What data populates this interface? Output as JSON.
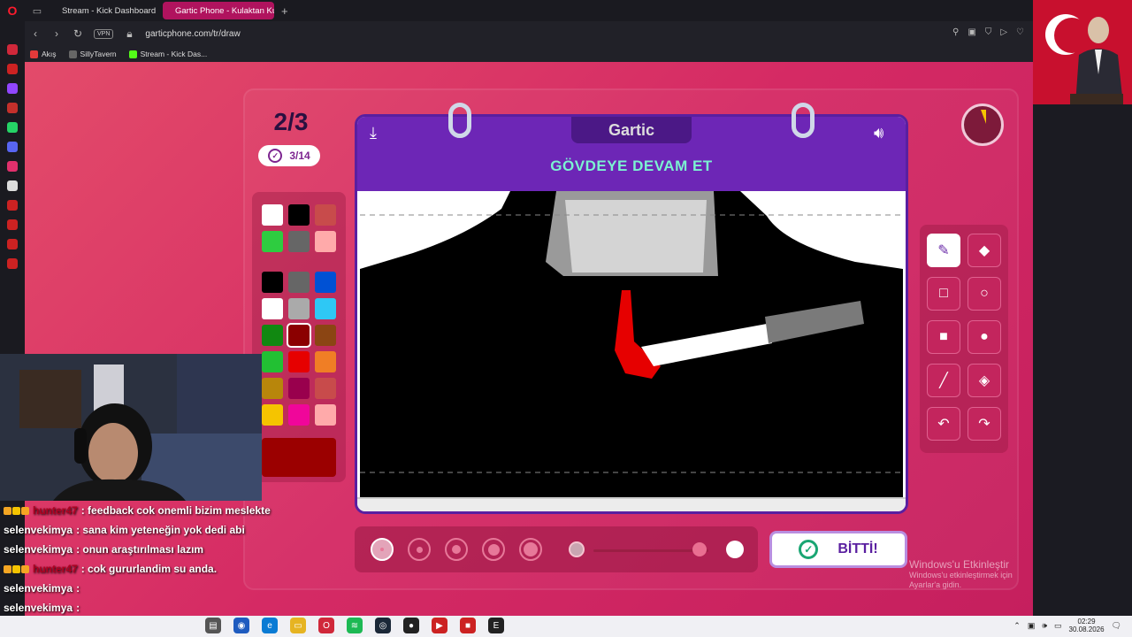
{
  "browser": {
    "tabs": [
      {
        "label": "Stream - Kick Dashboard",
        "active": false
      },
      {
        "label": "Gartic Phone - Kulaktan Ku",
        "active": true
      }
    ],
    "new_tab": "+",
    "url": "garticphone.com/tr/draw",
    "vpn": "VPN",
    "bookmarks": [
      "Akış",
      "SillyTavern",
      "Stream - Kick Das..."
    ]
  },
  "game": {
    "round": "2/3",
    "progress": "3/14",
    "logo": "Gartic",
    "prompt": "GÖVDEYE DEVAM ET",
    "done_label": "BİTTİ!",
    "timer_elapsed_fraction": 0.08,
    "palette": [
      "#ffffff",
      "#000000",
      "#c84b4b",
      "#2ecc40",
      "#666666",
      "#ffaaaa",
      "#000000",
      "#666666",
      "#0051d4",
      "#ffffff",
      "#aaaaaa",
      "#2ec8f5",
      "#118811",
      "#8b0000",
      "#8b4513",
      "#22c033",
      "#e60000",
      "#f07e25",
      "#b8860b",
      "#99004d",
      "#c84b4b",
      "#f5c400",
      "#f0069a",
      "#ffaaaa"
    ],
    "selected_color_index": 13,
    "current_color": "#9b0000",
    "brush_sizes": 5,
    "selected_size_index": 0,
    "opacity_fraction": 0.92,
    "tools": [
      {
        "name": "pencil-tool",
        "glyph": "✎",
        "active": true
      },
      {
        "name": "eraser-tool",
        "glyph": "◆",
        "active": false
      },
      {
        "name": "rectangle-outline-tool",
        "glyph": "□",
        "active": false
      },
      {
        "name": "ellipse-outline-tool",
        "glyph": "○",
        "active": false
      },
      {
        "name": "rectangle-fill-tool",
        "glyph": "■",
        "active": false
      },
      {
        "name": "ellipse-fill-tool",
        "glyph": "●",
        "active": false
      },
      {
        "name": "line-tool",
        "glyph": "╱",
        "active": false
      },
      {
        "name": "fill-bucket-tool",
        "glyph": "◈",
        "active": false
      },
      {
        "name": "undo-tool",
        "glyph": "↶",
        "active": false
      },
      {
        "name": "redo-tool",
        "glyph": "↷",
        "active": false
      }
    ]
  },
  "windows_notice": {
    "title": "Windows'u Etkinleştir",
    "subtitle": "Windows'u etkinleştirmek için Ayarlar'a gidin."
  },
  "chat": [
    {
      "user": "hunter47",
      "hidden": true,
      "message": ": feedback cok onemli bizim meslekte"
    },
    {
      "user": "selenvekimya",
      "hidden": false,
      "message": ": sana kim yeteneğin yok dedi abi"
    },
    {
      "user": "selenvekimya",
      "hidden": false,
      "message": ": onun araştırılması lazım"
    },
    {
      "user": "hunter47",
      "hidden": true,
      "message": ": cok gururlandim su anda."
    },
    {
      "user": "selenvekimya",
      "hidden": false,
      "message": ":"
    },
    {
      "user": "selenvekimya",
      "hidden": false,
      "message": ":"
    },
    {
      "user": "selenvekimya",
      "hidden": false,
      "message": ":"
    }
  ],
  "taskbar": {
    "time": "02:29",
    "date": "30.08.2026"
  },
  "colors": {
    "accent": "#6d26b6",
    "prompt_text": "#7bf3d1",
    "page_bg": "#d52a64"
  }
}
